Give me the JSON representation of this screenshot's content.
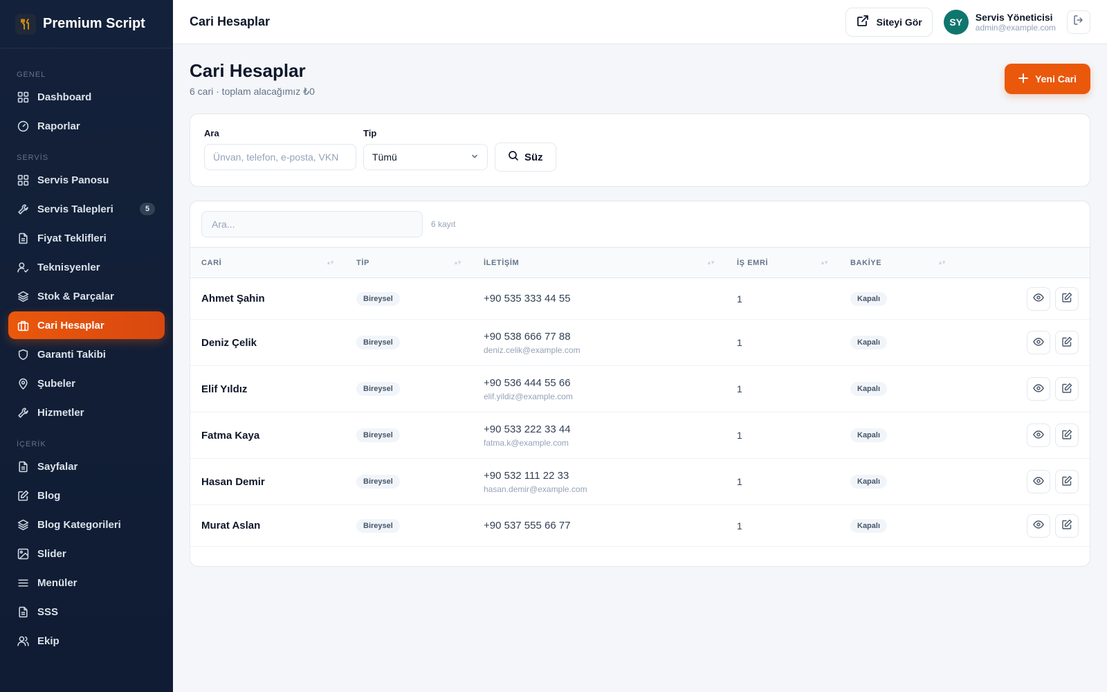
{
  "brand": {
    "name": "Premium Script",
    "icon": "fork-knife-icon"
  },
  "sidebar": {
    "sections": [
      {
        "label": "GENEL",
        "items": [
          {
            "label": "Dashboard",
            "icon": "grid-icon"
          },
          {
            "label": "Raporlar",
            "icon": "gauge-icon"
          }
        ]
      },
      {
        "label": "SERVİS",
        "items": [
          {
            "label": "Servis Panosu",
            "icon": "grid-icon"
          },
          {
            "label": "Servis Talepleri",
            "icon": "wrench-icon",
            "badge": "5"
          },
          {
            "label": "Fiyat Teklifleri",
            "icon": "document-icon"
          },
          {
            "label": "Teknisyenler",
            "icon": "user-check-icon"
          },
          {
            "label": "Stok & Parçalar",
            "icon": "layers-icon"
          },
          {
            "label": "Cari Hesaplar",
            "icon": "briefcase-icon",
            "active": true
          },
          {
            "label": "Garanti Takibi",
            "icon": "shield-icon"
          },
          {
            "label": "Şubeler",
            "icon": "map-pin-icon"
          },
          {
            "label": "Hizmetler",
            "icon": "wrench-icon"
          }
        ]
      },
      {
        "label": "İÇERİK",
        "items": [
          {
            "label": "Sayfalar",
            "icon": "document-icon"
          },
          {
            "label": "Blog",
            "icon": "edit-icon"
          },
          {
            "label": "Blog Kategorileri",
            "icon": "layers-icon"
          },
          {
            "label": "Slider",
            "icon": "image-icon"
          },
          {
            "label": "Menüler",
            "icon": "menu-icon"
          },
          {
            "label": "SSS",
            "icon": "document-icon"
          },
          {
            "label": "Ekip",
            "icon": "users-icon"
          }
        ]
      }
    ]
  },
  "topbar": {
    "title": "Cari Hesaplar",
    "site_button": "Siteyi Gör",
    "user": {
      "initials": "SY",
      "name": "Servis Yöneticisi",
      "email": "admin@example.com"
    }
  },
  "page": {
    "title": "Cari Hesaplar",
    "subtitle": "6 cari · toplam alacağımız ₺0",
    "new_button": "Yeni Cari"
  },
  "filters": {
    "search_label": "Ara",
    "search_placeholder": "Ünvan, telefon, e-posta, VKN",
    "type_label": "Tip",
    "type_value": "Tümü",
    "submit": "Süz"
  },
  "table": {
    "search_placeholder": "Ara...",
    "count": "6 kayıt",
    "columns": [
      "CARİ",
      "TİP",
      "İLETİŞİM",
      "İŞ EMRİ",
      "BAKİYE"
    ],
    "rows": [
      {
        "name": "Ahmet Şahin",
        "type": "Bireysel",
        "phone": "+90 535 333 44 55",
        "email": "",
        "orders": "1",
        "balance": "Kapalı"
      },
      {
        "name": "Deniz Çelik",
        "type": "Bireysel",
        "phone": "+90 538 666 77 88",
        "email": "deniz.celik@example.com",
        "orders": "1",
        "balance": "Kapalı"
      },
      {
        "name": "Elif Yıldız",
        "type": "Bireysel",
        "phone": "+90 536 444 55 66",
        "email": "elif.yildiz@example.com",
        "orders": "1",
        "balance": "Kapalı"
      },
      {
        "name": "Fatma Kaya",
        "type": "Bireysel",
        "phone": "+90 533 222 33 44",
        "email": "fatma.k@example.com",
        "orders": "1",
        "balance": "Kapalı"
      },
      {
        "name": "Hasan Demir",
        "type": "Bireysel",
        "phone": "+90 532 111 22 33",
        "email": "hasan.demir@example.com",
        "orders": "1",
        "balance": "Kapalı"
      },
      {
        "name": "Murat Aslan",
        "type": "Bireysel",
        "phone": "+90 537 555 66 77",
        "email": "",
        "orders": "1",
        "balance": "Kapalı"
      }
    ]
  },
  "colors": {
    "accent": "#ea580c",
    "sidebar": "#14213a",
    "avatar": "#0f766e"
  }
}
